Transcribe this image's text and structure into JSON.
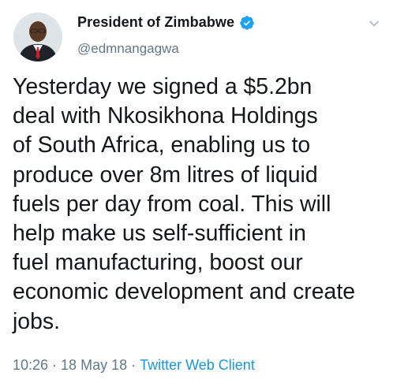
{
  "author": {
    "display_name": "President of Zimbabwe",
    "handle": "@edmnangagwa",
    "verified": true,
    "avatar_icon": "person-portrait-icon"
  },
  "tweet": {
    "text": "Yesterday we signed a $5.2bn\ndeal with Nkosikhona Holdings\nof South Africa, enabling us to\nproduce over 8m litres of liquid\nfuels per day from coal. This will\nhelp make us self-sufficient in\nfuel manufacturing, boost our\neconomic development and create\njobs.",
    "time": "10:26",
    "separator": "·",
    "date": "18 May 18",
    "client": "Twitter Web Client"
  },
  "colors": {
    "verified_blue": "#1da1f2",
    "link_blue": "#1b95e0",
    "secondary_text": "#657786",
    "primary_text": "#14171a"
  },
  "icons": {
    "verified": "verified-badge-icon",
    "menu": "chevron-down-icon"
  }
}
